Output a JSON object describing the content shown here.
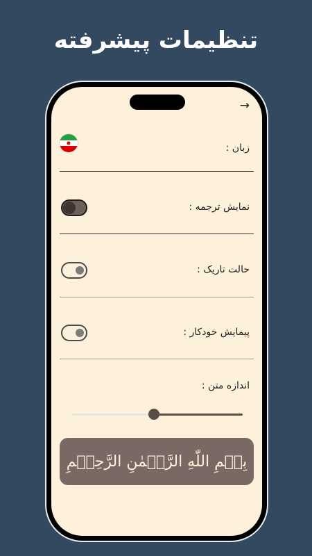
{
  "headline": "تنظیمات پیشرفته",
  "header": {
    "back_icon": "arrow-right-icon"
  },
  "settings": {
    "language": {
      "label": "زبان :",
      "flag_icon": "iran-flag-icon"
    },
    "show_translation": {
      "label": "نمایش ترجمه :",
      "enabled": true
    },
    "dark_mode": {
      "label": "حالت تاریک :",
      "enabled": false
    },
    "auto_scroll": {
      "label": "پیمایش خودکار :",
      "enabled": false
    },
    "text_size": {
      "label": "اندازه متن :",
      "value_fraction": 0.48
    }
  },
  "preview": {
    "text": "بِسۡمِ اللّٰهِ الرَّحۡمٰنِ الرَّحِيۡمِ"
  },
  "colors": {
    "background": "#33495f",
    "screen": "#fdf1db",
    "accent": "#786964"
  }
}
